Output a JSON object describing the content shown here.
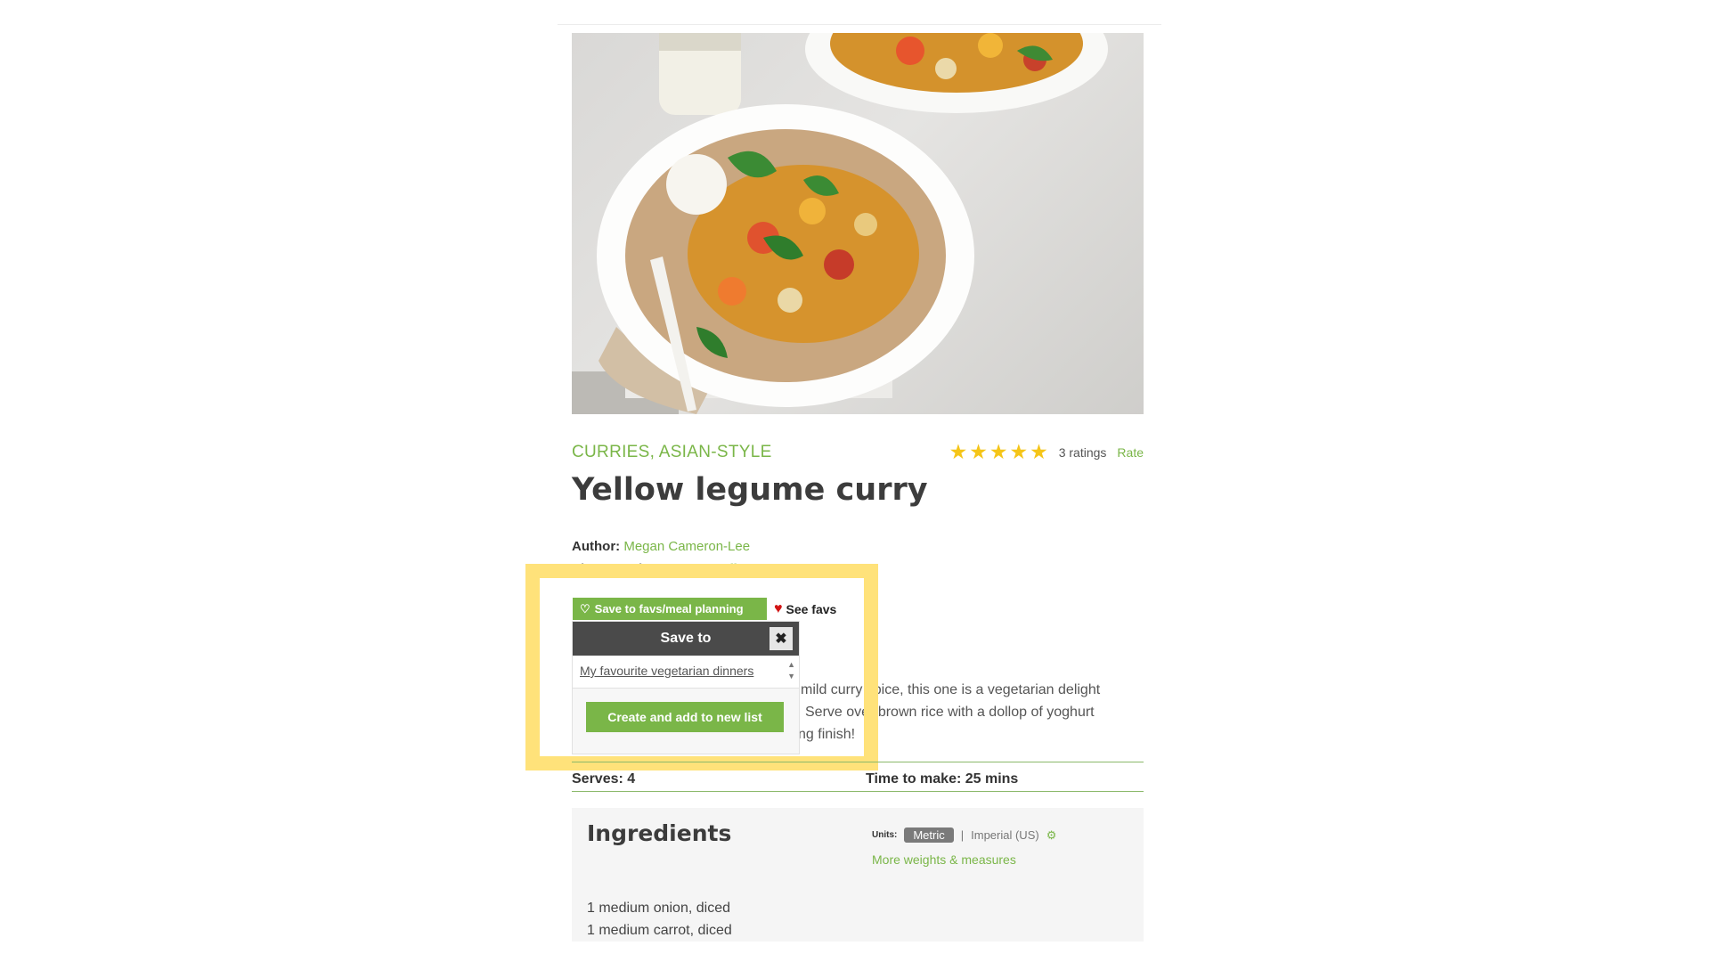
{
  "category": "CURRIES, ASIAN-STYLE",
  "rating": {
    "stars": 5,
    "count_label": "3 ratings",
    "rate_label": "Rate"
  },
  "recipe": {
    "title": "Yellow legume curry",
    "author_label": "Author:",
    "author": "Megan Cameron-Lee",
    "photographer_label": "Photographer:",
    "photographer": "James Moffatt"
  },
  "favs": {
    "save_label": "Save to favs/meal planning",
    "see_favs_label": "See favs"
  },
  "popup": {
    "title": "Save to",
    "close_glyph": "✖",
    "lists": [
      "My favourite vegetarian dinners"
    ],
    "create_label": "Create and add to new list"
  },
  "description_lines": [
    "mild curry spice, this one is a vegetarian delight",
    "Serve over brown rice with a dollop of yoghurt",
    "ng finish!"
  ],
  "serves": "Serves: 4",
  "time": "Time to make: 25 mins",
  "ingredients": {
    "heading": "Ingredients",
    "units_label": "Units:",
    "metric": "Metric",
    "separator": "|",
    "imperial": "Imperial (US)",
    "more_link": "More weights & measures",
    "items": [
      "1 medium onion, diced",
      "1 medium carrot, diced"
    ]
  },
  "colors": {
    "accent": "#7ab648",
    "star": "#f5c518",
    "highlight": "#ffe27a",
    "popup_header": "#4a4a4a"
  },
  "icons": {
    "save": "heart-outline-icon",
    "see_favs": "heart-icon",
    "settings": "gear-icon"
  }
}
